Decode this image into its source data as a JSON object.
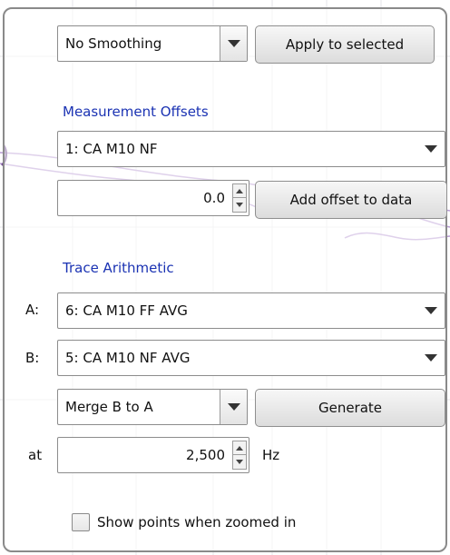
{
  "smoothing": {
    "selected": "No Smoothing"
  },
  "apply_button": {
    "label": "Apply to selected"
  },
  "measurement_offsets": {
    "title": "Measurement Offsets",
    "selected_measurement": "1: CA M10 NF",
    "offset_value": "0.0",
    "add_offset_label": "Add offset to data"
  },
  "trace_arithmetic": {
    "title": "Trace Arithmetic",
    "a_label": "A:",
    "a_selected": "6: CA M10 FF AVG",
    "b_label": "B:",
    "b_selected": "5: CA M10 NF AVG",
    "operation_selected": "Merge B to A",
    "generate_label": "Generate",
    "at_label": "at",
    "frequency_value": "2,500",
    "unit_label": "Hz"
  },
  "show_points": {
    "label": "Show points when zoomed in",
    "checked": false
  },
  "colors": {
    "section_title": "#1b33b3",
    "trace": "#a98bc6"
  }
}
